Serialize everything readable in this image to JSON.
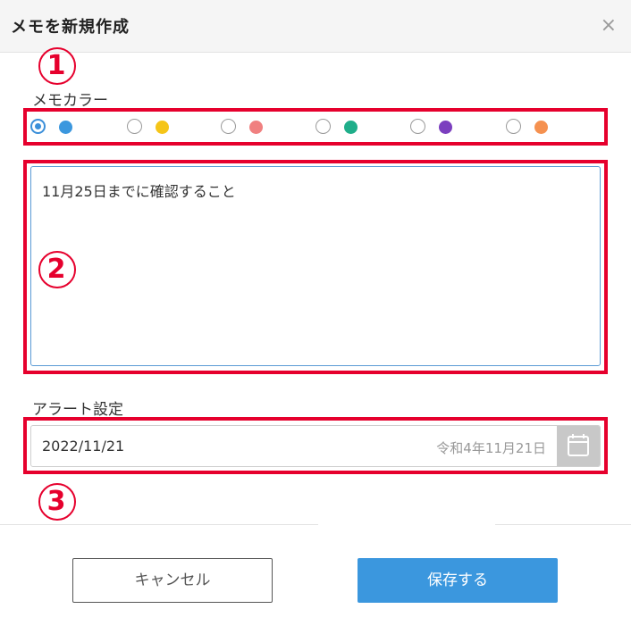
{
  "dialog": {
    "title": "メモを新規作成",
    "close_symbol": "×"
  },
  "annotations": {
    "badge1": "1",
    "badge2": "2",
    "badge3": "3",
    "color": "#e6002d"
  },
  "memo_color": {
    "label": "メモカラー",
    "selected_index": 0,
    "options": [
      {
        "name": "blue",
        "color": "#3b97de"
      },
      {
        "name": "yellow",
        "color": "#f5c518"
      },
      {
        "name": "pink",
        "color": "#f08080"
      },
      {
        "name": "green",
        "color": "#1fae8a"
      },
      {
        "name": "purple",
        "color": "#7b3fbf"
      },
      {
        "name": "orange",
        "color": "#f59150"
      }
    ]
  },
  "memo": {
    "value": "11月25日までに確認すること"
  },
  "alert": {
    "label": "アラート設定",
    "date_value": "2022/11/21",
    "date_japanese": "令和4年11月21日",
    "icon": "calendar-icon"
  },
  "buttons": {
    "cancel_label": "キャンセル",
    "save_label": "保存する"
  }
}
